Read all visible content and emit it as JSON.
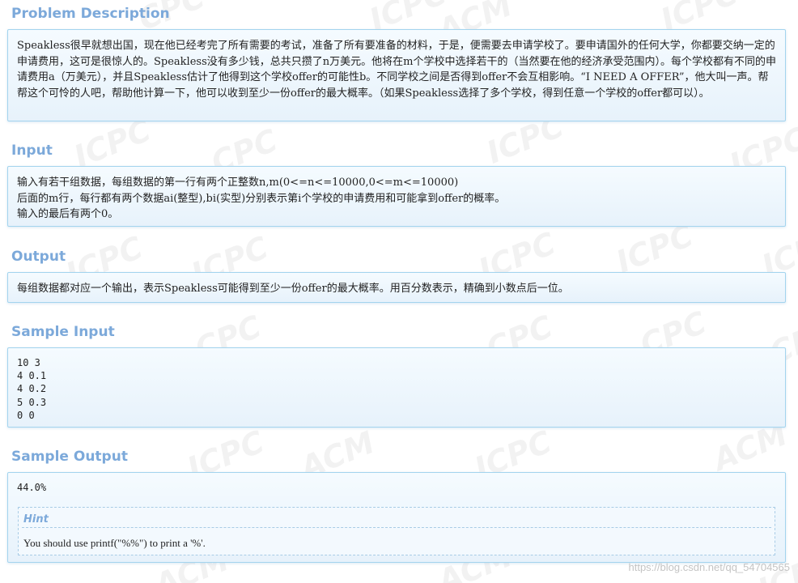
{
  "watermark": {
    "texts": [
      "CPC",
      "ICPC",
      "ICPC",
      "ICPC",
      "CPC",
      "ICPC",
      "ICPC",
      "ICPC",
      "ICPC",
      "ICPC",
      "ICPC",
      "ICPC",
      "CPC",
      "CPC",
      "CPC",
      "CPC",
      "ACM",
      "ACM",
      "ACM",
      "ACM",
      "ACM",
      "ICPC",
      "ICPC",
      "ICPC"
    ]
  },
  "sections": {
    "description": {
      "title": "Problem Description",
      "text": "Speakless很早就想出国，现在他已经考完了所有需要的考试，准备了所有要准备的材料，于是，便需要去申请学校了。要申请国外的任何大学，你都要交纳一定的申请费用，这可是很惊人的。Speakless没有多少钱，总共只攒了n万美元。他将在m个学校中选择若干的（当然要在他的经济承受范围内）。每个学校都有不同的申请费用a（万美元），并且Speakless估计了他得到这个学校offer的可能性b。不同学校之间是否得到offer不会互相影响。“I NEED A OFFER”，他大叫一声。帮帮这个可怜的人吧，帮助他计算一下，他可以收到至少一份offer的最大概率。（如果Speakless选择了多个学校，得到任意一个学校的offer都可以）。"
    },
    "input": {
      "title": "Input",
      "lines": [
        "输入有若干组数据，每组数据的第一行有两个正整数n,m(0<=n<=10000,0<=m<=10000)",
        "后面的m行，每行都有两个数据ai(整型),bi(实型)分别表示第i个学校的申请费用和可能拿到offer的概率。",
        "输入的最后有两个0。"
      ]
    },
    "output": {
      "title": "Output",
      "text": "每组数据都对应一个输出，表示Speakless可能得到至少一份offer的最大概率。用百分数表示，精确到小数点后一位。"
    },
    "sample_input": {
      "title": "Sample Input",
      "code": "10 3\n4 0.1\n4 0.2\n5 0.3\n0 0"
    },
    "sample_output": {
      "title": "Sample Output",
      "code": "44.0%",
      "hint_title": "Hint",
      "hint_text": "You should use printf(\"%%\") to print a '%'."
    }
  },
  "footer": {
    "watermark": "https://blog.csdn.net/qq_54704565"
  },
  "colors": {
    "title": "#7ca9da",
    "panel_border": "#a3d4ee",
    "panel_bg": "#eef6fc"
  }
}
